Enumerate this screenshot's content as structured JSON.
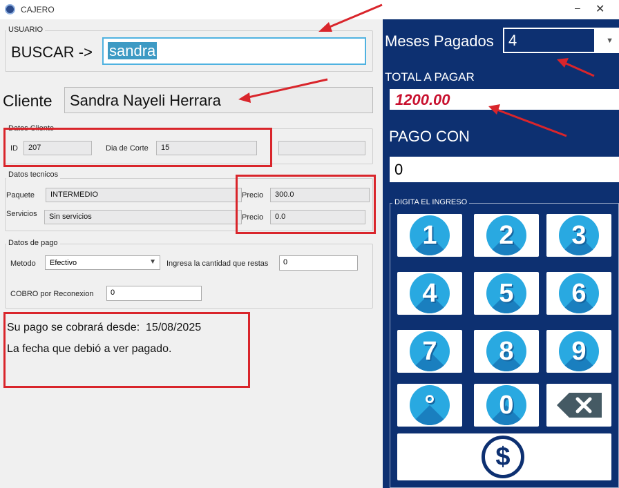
{
  "window": {
    "title": "CAJERO",
    "minimize": "–",
    "close": "✕"
  },
  "usuario": {
    "legend": "USUARIO",
    "buscar_label": "BUSCAR ->",
    "search_value": "sandra"
  },
  "cliente": {
    "label": "Cliente",
    "name": "Sandra Nayeli Herrara"
  },
  "datos_cliente": {
    "legend": "Datos Cliente",
    "id_label": "ID",
    "id_value": "207",
    "dia_corte_label": "Dia de Corte",
    "dia_corte_value": "15",
    "extra_value": ""
  },
  "datos_tecnicos": {
    "legend": "Datos tecnicos",
    "paquete_label": "Paquete",
    "paquete_value": "INTERMEDIO",
    "servicios_label": "Servicios",
    "servicios_value": "Sin servicios",
    "precio1_label": "Precio",
    "precio1_value": "300.0",
    "precio2_label": "Precio",
    "precio2_value": "0.0"
  },
  "datos_pago": {
    "legend": "Datos de pago",
    "metodo_label": "Metodo",
    "metodo_value": "Efectivo",
    "restas_label": "Ingresa la cantidad que restas",
    "restas_value": "0",
    "reconexion_label": "COBRO por Reconexion",
    "reconexion_value": "0"
  },
  "info": {
    "cobro_label": "Su pago se cobrará desde:",
    "cobro_date": "15/08/2025",
    "fecha_label": "La fecha que debió a ver pagado."
  },
  "right": {
    "meses_label": "Meses Pagados",
    "meses_value": "4",
    "total_label": "TOTAL A PAGAR",
    "total_value": "1200.00",
    "pago_con_label": "PAGO CON",
    "pago_con_value": "0",
    "keypad_legend": "DIGITA EL INGRESO",
    "keys": [
      "1",
      "2",
      "3",
      "4",
      "5",
      "6",
      "7",
      "8",
      "9",
      "°",
      "0"
    ],
    "pay_symbol": "$"
  },
  "colors": {
    "accent_red": "#d9252b",
    "panel_blue": "#0d3071",
    "key_blue": "#29a9e1",
    "total_red": "#c8102e"
  }
}
